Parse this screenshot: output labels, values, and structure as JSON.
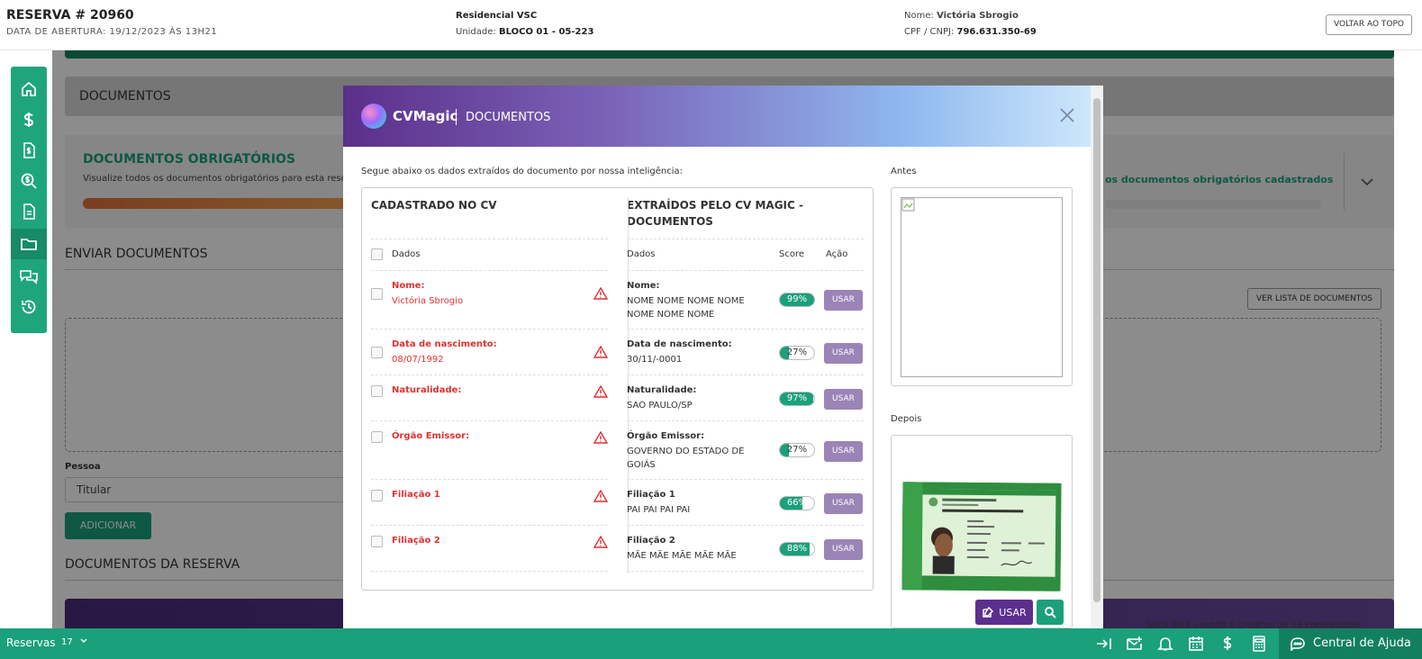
{
  "topbar": {
    "reserva": "RESERVA # 20960",
    "abertura": "DATA DE ABERTURA: 19/12/2023 ÀS 13H21",
    "empreendimento": "Residencial VSC",
    "unidade_label": "Unidade:",
    "unidade": "BLOCO 01 - 05-223",
    "nome_label": "Nome:",
    "nome": "Victória Sbrogio",
    "cpf_label": "CPF / CNPJ:",
    "cpf": "796.631.350-69",
    "voltar": "VOLTAR AO TOPO"
  },
  "sidenav": {
    "items": [
      "home-icon",
      "dollar-icon",
      "invoice-icon",
      "search-money-icon",
      "document-icon",
      "folder-icon",
      "chat-icon",
      "history-icon"
    ],
    "active_index": 5
  },
  "background": {
    "documentos": "DOCUMENTOS",
    "obrig_title": "DOCUMENTOS OBRIGATÓRIOS",
    "obrig_desc": "Visualize todos os documentos obrigatórios para esta rese",
    "obrig_right": "os documentos obrigatórios cadastrados",
    "enviar": "ENVIAR DOCUMENTOS",
    "ver_lista": "VER LISTA DE DOCUMENTOS",
    "pessoa_label": "Pessoa",
    "pessoa_value": "Titular",
    "adicionar": "ADICIONAR",
    "docs_reserva": "DOCUMENTOS DA RESERVA",
    "credit_text": "Você está usando 0 créditos de 10 contratados"
  },
  "modal": {
    "brand": "CVMagic",
    "title": "DOCUMENTOS",
    "intro": "Segue abaixo os dados extraídos do documento por nossa inteligência:",
    "col_left": "CADASTRADO NO CV",
    "col_right_line1": "EXTRAÍDOS PELO CV MAGIC -",
    "col_right_line2": "DOCUMENTOS",
    "dados": "Dados",
    "score": "Score",
    "acao": "Ação",
    "usar": "USAR",
    "antes": "Antes",
    "depois": "Depois",
    "usar_button": "USAR",
    "rows": [
      {
        "label": "Nome:",
        "value": "Victória Sbrogio",
        "ext_label": "Nome:",
        "ext_value": "NOME NOME NOME NOME NOME NOME NOME",
        "score": 99,
        "score_text": "99%"
      },
      {
        "label": "Data de nascimento:",
        "value": "08/07/1992",
        "ext_label": "Data de nascimento:",
        "ext_value": "30/11/-0001",
        "score": 27,
        "score_text": "27%"
      },
      {
        "label": "Naturalidade:",
        "value": "",
        "ext_label": "Naturalidade:",
        "ext_value": "SAO PAULO/SP",
        "score": 97,
        "score_text": "97%"
      },
      {
        "label": "Órgão Emissor:",
        "value": "",
        "ext_label": "Órgão Emissor:",
        "ext_value": "GOVERNO DO ESTADO DE GOIÁS",
        "score": 27,
        "score_text": "27%"
      },
      {
        "label": "Filiação 1",
        "value": "",
        "ext_label": "Filiação 1",
        "ext_value": "PAI PAI PAI PAI",
        "score": 66,
        "score_text": "66%"
      },
      {
        "label": "Filiação 2",
        "value": "",
        "ext_label": "Filiação 2",
        "ext_value": "MÃE MÃE MÃE MÃE MÃE",
        "score": 88,
        "score_text": "88%"
      }
    ]
  },
  "bottombar": {
    "reservas": "Reservas",
    "count": "17",
    "ajuda": "Central de Ajuda"
  },
  "colors": {
    "green": "#1aa07a",
    "purple": "#5c2f8e",
    "red": "#e03131",
    "usar": "#9b84b8"
  }
}
